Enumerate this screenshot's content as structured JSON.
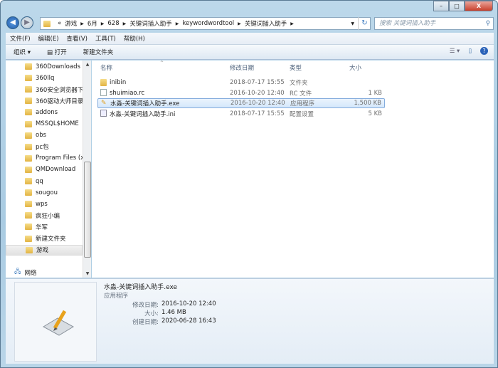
{
  "window": {
    "minimize": "–",
    "maximize": "□",
    "close": "X"
  },
  "address": {
    "overflow": "«",
    "crumbs": [
      "游戏",
      "6月",
      "628",
      "关键词插入助手",
      "keywordwordtool",
      "关键词插入助手"
    ],
    "search_placeholder": "搜索 关键词插入助手"
  },
  "menu": [
    "文件(F)",
    "编辑(E)",
    "查看(V)",
    "工具(T)",
    "帮助(H)"
  ],
  "toolbar": {
    "organize": "组织 ▾",
    "open": "打开",
    "new_folder": "新建文件夹"
  },
  "nav": {
    "items": [
      "360Downloads",
      "360llq",
      "360安全浏览器下",
      "360驱动大师目录",
      "addons",
      "MSSQL$HOME",
      "obs",
      "pc包",
      "Program Files (x",
      "QMDownload",
      "qq",
      "sougou",
      "wps",
      "疯狂小编",
      "华军",
      "新建文件夹",
      "游戏"
    ],
    "selected": "游戏",
    "network": "网络"
  },
  "columns": {
    "name": "名称",
    "modified": "修改日期",
    "type": "类型",
    "size": "大小"
  },
  "files": [
    {
      "name": "inibin",
      "modified": "2018-07-17 15:55",
      "type": "文件夹",
      "size": "",
      "icon": "folder"
    },
    {
      "name": "shuimiao.rc",
      "modified": "2016-10-20 12:40",
      "type": "RC 文件",
      "size": "1 KB",
      "icon": "file"
    },
    {
      "name": "水淼-关键词插入助手.exe",
      "modified": "2016-10-20 12:40",
      "type": "应用程序",
      "size": "1,500 KB",
      "icon": "exe"
    },
    {
      "name": "水淼-关键词插入助手.ini",
      "modified": "2018-07-17 15:55",
      "type": "配置设置",
      "size": "5 KB",
      "icon": "ini"
    }
  ],
  "details": {
    "name": "水淼-关键词插入助手.exe",
    "type": "应用程序",
    "modified_label": "修改日期:",
    "modified": "2016-10-20 12:40",
    "size_label": "大小:",
    "size": "1.46 MB",
    "created_label": "创建日期:",
    "created": "2020-06-28 16:43"
  }
}
